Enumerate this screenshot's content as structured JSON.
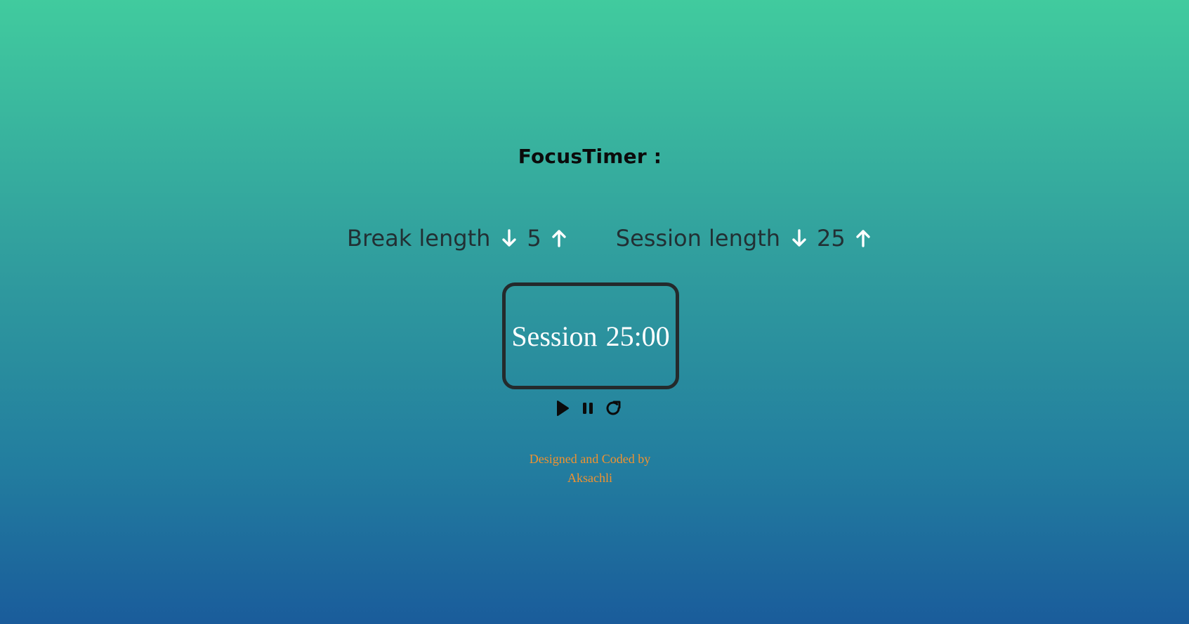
{
  "app": {
    "title": "FocusTimer :"
  },
  "break_control": {
    "label": "Break length",
    "value": "5",
    "decrement_icon": "arrow-down-icon",
    "increment_icon": "arrow-up-icon"
  },
  "session_control": {
    "label": "Session length",
    "value": "25",
    "decrement_icon": "arrow-down-icon",
    "increment_icon": "arrow-up-icon"
  },
  "timer": {
    "label": "Session",
    "time": "25:00"
  },
  "player": {
    "play_icon": "play-icon",
    "pause_icon": "pause-icon",
    "reset_icon": "refresh-icon"
  },
  "footer": {
    "line1": "Designed and Coded by",
    "author": "Aksachli"
  },
  "colors": {
    "gradient_top": "#41cb9e",
    "gradient_bottom": "#1a5c9b",
    "footer_text": "#f2922f",
    "timer_border": "#242a2c",
    "timer_text": "#ffffff"
  }
}
